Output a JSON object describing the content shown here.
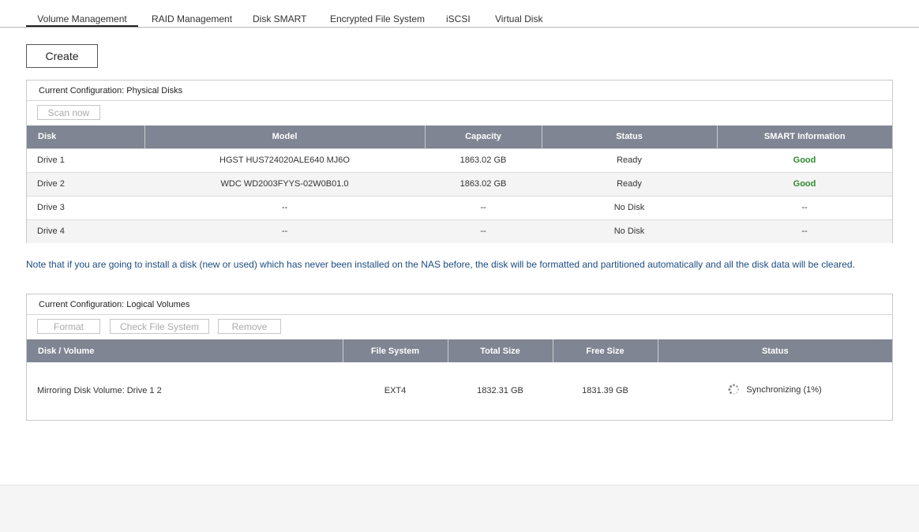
{
  "tabs": [
    {
      "label": "Volume Management",
      "active": true
    },
    {
      "label": "RAID Management"
    },
    {
      "label": "Disk SMART"
    },
    {
      "label": "Encrypted File System"
    },
    {
      "label": "iSCSI"
    },
    {
      "label": "Virtual Disk"
    }
  ],
  "create_label": "Create",
  "physical": {
    "title": "Current Configuration: Physical Disks",
    "scan_label": "Scan now",
    "columns": [
      "Disk",
      "Model",
      "Capacity",
      "Status",
      "SMART Information"
    ],
    "rows": [
      {
        "disk": "Drive 1",
        "model": "HGST HUS724020ALE640 MJ6O",
        "capacity": "1863.02 GB",
        "status": "Ready",
        "smart": "Good"
      },
      {
        "disk": "Drive 2",
        "model": "WDC WD2003FYYS-02W0B01.0",
        "capacity": "1863.02 GB",
        "status": "Ready",
        "smart": "Good"
      },
      {
        "disk": "Drive 3",
        "model": "--",
        "capacity": "--",
        "status": "No Disk",
        "smart": "--"
      },
      {
        "disk": "Drive 4",
        "model": "--",
        "capacity": "--",
        "status": "No Disk",
        "smart": "--"
      }
    ]
  },
  "note": "Note that if you are going to install a disk (new or used) which has never been installed on the NAS before, the disk will be formatted and partitioned automatically and all the disk data will be cleared.",
  "logical": {
    "title": "Current Configuration: Logical Volumes",
    "format_label": "Format",
    "check_label": "Check File System",
    "remove_label": "Remove",
    "columns": [
      "Disk / Volume",
      "File System",
      "Total Size",
      "Free Size",
      "Status"
    ],
    "row": {
      "volume": "Mirroring Disk Volume: Drive 1 2",
      "fs": "EXT4",
      "total": "1832.31 GB",
      "free": "1831.39 GB",
      "status": "Synchronizing (1%)",
      "status_icon": "spinner-icon"
    }
  },
  "colors": {
    "header_bg": "#7f8592",
    "good": "#2e8b2e",
    "note": "#1d4c82"
  }
}
